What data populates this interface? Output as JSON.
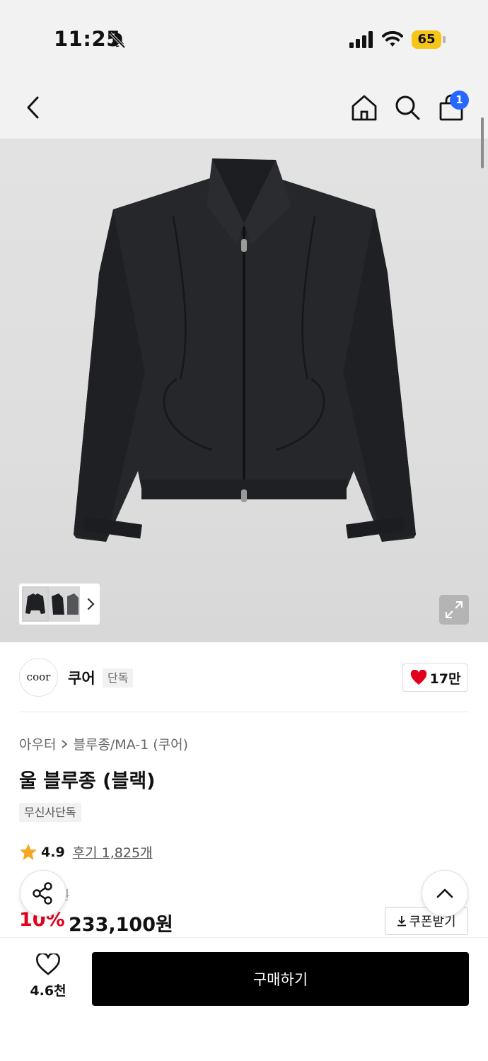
{
  "status_bar": {
    "time": "11:25",
    "battery_level": "65",
    "icons": [
      "bell-off-icon",
      "signal-icon",
      "wifi-icon",
      "battery-icon"
    ],
    "battery_color": "#f5c518"
  },
  "header": {
    "icons": [
      "back-arrow-icon",
      "home-icon",
      "search-icon",
      "shopping-bag-icon"
    ],
    "cart_badge": "1",
    "badge_color": "#2667ff"
  },
  "gallery": {
    "icons": [
      "chevron-right-icon",
      "expand-icon"
    ]
  },
  "brand": {
    "logo_text": "coor",
    "name": "쿠어",
    "tag": "단독",
    "like_count": "17만",
    "heart_color": "#e3001b"
  },
  "product": {
    "breadcrumb": [
      "아우터",
      "블루종/MA-1 (쿠어)"
    ],
    "title": "울 블루종 (블랙)",
    "exclusive_tag": "무신사단독",
    "rating": "4.9",
    "review_link": "후기 1,825개",
    "original_price_visible": "0원",
    "discount_rate": "10%",
    "sale_price": "233,100원",
    "coupon_label": "쿠폰받기",
    "discount_color": "#e3001b",
    "star_color": "#f5a623"
  },
  "bottom_bar": {
    "wish_count": "4.6천",
    "buy_label": "구매하기"
  }
}
